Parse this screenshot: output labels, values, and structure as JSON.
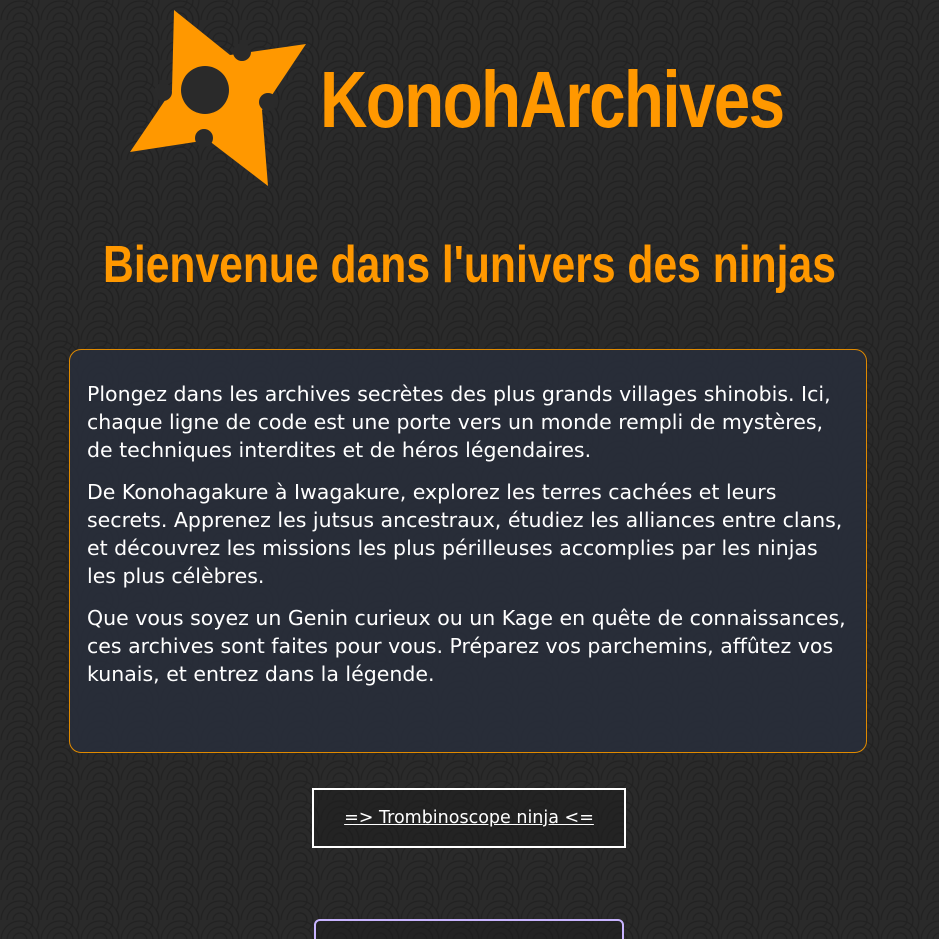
{
  "brand": {
    "name": "KonohArchives",
    "logo_icon": "shuriken-icon",
    "accent_color": "#ff9800"
  },
  "tagline": "Bienvenue dans l'univers des ninjas",
  "intro": {
    "paragraphs": [
      "Plongez dans les archives secrètes des plus grands villages shinobis. Ici, chaque ligne de code est une porte vers un monde rempli de mystères, de techniques interdites et de héros légendaires.",
      "De Konohagakure à Iwagakure, explorez les terres cachées et leurs secrets. Apprenez les jutsus ancestraux, étudiez les alliances entre clans, et découvrez les missions les plus périlleuses accomplies par les ninjas les plus célèbres.",
      "Que vous soyez un Genin curieux ou un Kage en quête de connaissances, ces archives sont faites pour vous. Préparez vos parchemins, affûtez vos kunais, et entrez dans la légende."
    ]
  },
  "cta": {
    "label": "=> Trombinoscope ninja <="
  }
}
